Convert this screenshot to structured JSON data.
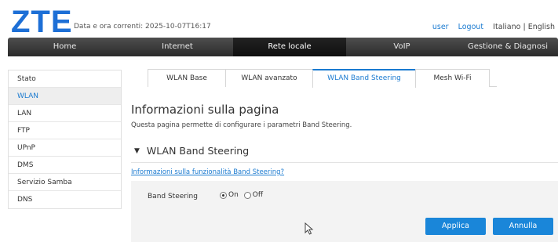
{
  "header": {
    "logo": "ZTE",
    "datetime": "Data e ora correnti: 2025-10-07T16:17",
    "links": {
      "user": "user",
      "logout": "Logout",
      "language": "Italiano | English"
    }
  },
  "mainnav": [
    {
      "label": "Home"
    },
    {
      "label": "Internet"
    },
    {
      "label": "Rete locale"
    },
    {
      "label": "VoIP"
    },
    {
      "label": "Gestione & Diagnosi"
    }
  ],
  "sidebar": [
    {
      "label": "Stato"
    },
    {
      "label": "WLAN"
    },
    {
      "label": "LAN"
    },
    {
      "label": "FTP"
    },
    {
      "label": "UPnP"
    },
    {
      "label": "DMS"
    },
    {
      "label": "Servizio Samba"
    },
    {
      "label": "DNS"
    }
  ],
  "tabs": [
    {
      "label": "WLAN Base"
    },
    {
      "label": "WLAN avanzato"
    },
    {
      "label": "WLAN Band Steering"
    },
    {
      "label": "Mesh Wi-Fi"
    }
  ],
  "content": {
    "title": "Informazioni sulla pagina",
    "description": "Questa pagina permette di configurare i parametri Band Steering.",
    "section_title": "WLAN Band Steering",
    "info_link": "Informazioni sulla funzionalità Band Steering?",
    "field_label": "Band Steering",
    "radio_on": "On",
    "radio_off": "Off",
    "selected": "On"
  },
  "buttons": {
    "apply": "Applica",
    "cancel": "Annulla"
  },
  "colors": {
    "accent": "#1a7ad0",
    "button": "#1a86d9",
    "nav": "#3a3a3a"
  }
}
